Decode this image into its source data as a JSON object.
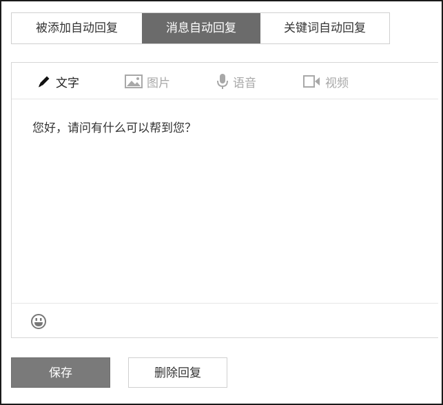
{
  "tabs": [
    {
      "label": "被添加自动回复",
      "active": false
    },
    {
      "label": "消息自动回复",
      "active": true
    },
    {
      "label": "关键词自动回复",
      "active": false
    }
  ],
  "toolbar": {
    "items": [
      {
        "label": "文字",
        "icon": "pencil-icon",
        "active": true
      },
      {
        "label": "图片",
        "icon": "image-icon",
        "active": false
      },
      {
        "label": "语音",
        "icon": "microphone-icon",
        "active": false
      },
      {
        "label": "视频",
        "icon": "video-camera-icon",
        "active": false
      }
    ]
  },
  "editor": {
    "content": "您好，请问有什么可以帮到您？"
  },
  "emoji": {
    "icon": "smiley-icon"
  },
  "buttons": {
    "save_label": "保存",
    "delete_label": "删除回复"
  },
  "colors": {
    "active_tab_bg": "#6b6b6b",
    "save_button_bg": "#7a7a7a",
    "inactive_tool_text": "#a8a8a8"
  }
}
